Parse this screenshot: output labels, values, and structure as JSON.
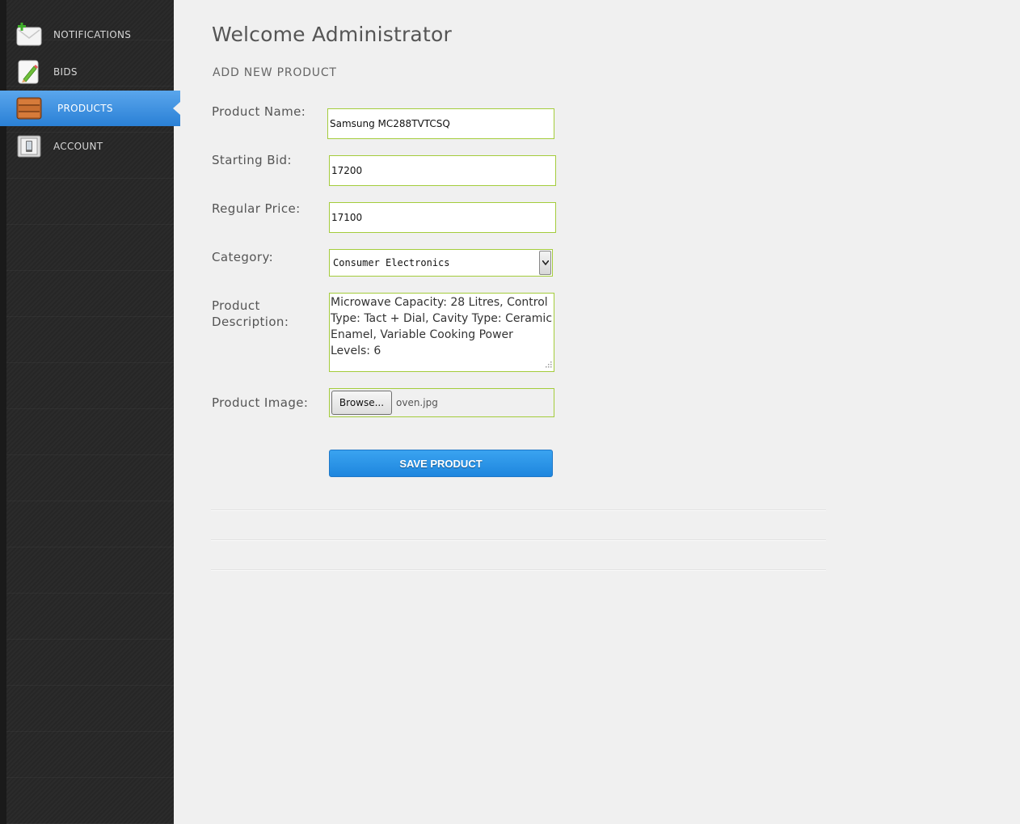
{
  "sidebar": {
    "items": [
      {
        "label": "NOTIFICATIONS",
        "icon": "envelope-add-icon",
        "active": false
      },
      {
        "label": "BIDS",
        "icon": "pencil-note-icon",
        "active": false
      },
      {
        "label": "PRODUCTS",
        "icon": "crate-icon",
        "active": true
      },
      {
        "label": "ACCOUNT",
        "icon": "phone-icon",
        "active": false
      }
    ]
  },
  "header": {
    "title": "Welcome Administrator",
    "section": "ADD NEW PRODUCT"
  },
  "form": {
    "product_name_label": "Product Name:",
    "product_name_value": "Samsung MC288TVTCSQ",
    "starting_bid_label": "Starting Bid:",
    "starting_bid_value": "17200",
    "regular_price_label": "Regular Price:",
    "regular_price_value": "17100",
    "category_label": "Category:",
    "category_value": "Consumer Electronics",
    "description_label_line1": "Product",
    "description_label_line2": "Description:",
    "description_value": "Microwave Capacity: 28 Litres, Control Type: Tact + Dial, Cavity Type: Ceramic Enamel, Variable Cooking Power Levels: 6",
    "image_label": "Product Image:",
    "browse_label": "Browse...",
    "image_file": "oven.jpg",
    "save_label": "SAVE PRODUCT"
  },
  "colors": {
    "accent": "#2a80d6",
    "input_border": "#a4cc3c",
    "sidebar_bg": "#2b2b2b",
    "page_bg": "#f0f0f0"
  }
}
